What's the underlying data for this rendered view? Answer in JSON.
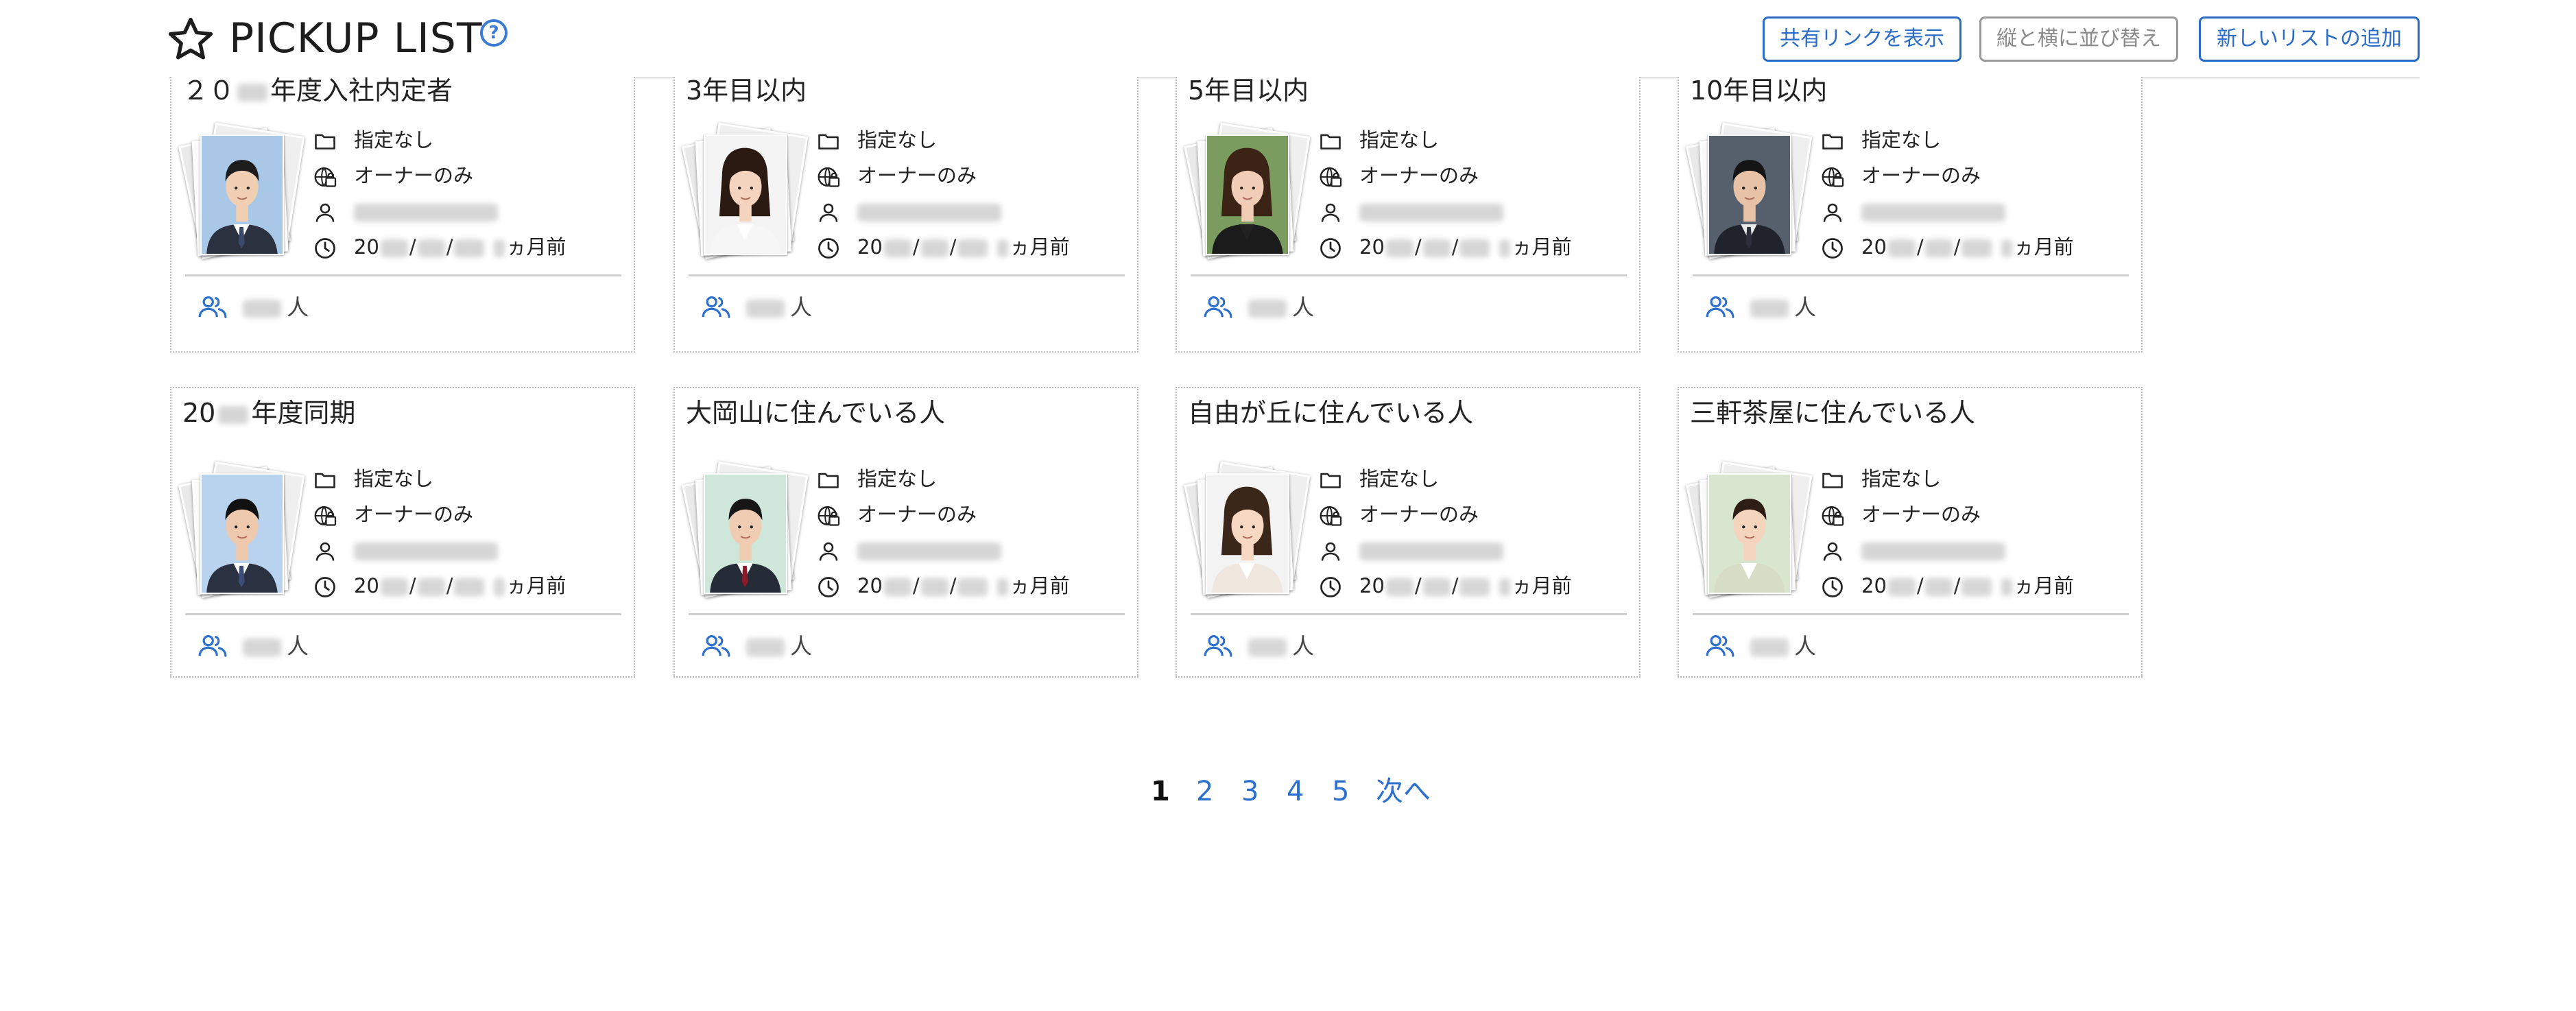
{
  "header": {
    "title": "PICKUP LIST",
    "help_glyph": "?",
    "buttons": {
      "share": "共有リンクを表示",
      "reorder": "縦と横に並び替え",
      "add_list": "新しいリストの追加"
    }
  },
  "cards": [
    {
      "title_pre": "２０",
      "title_post": "年度入社内定者",
      "folder": "指定なし",
      "visibility": "オーナーのみ",
      "date_prefix": "20",
      "sep": "/",
      "date_suffix": "ヵ月前",
      "count_suffix": "人",
      "photo": "man-1"
    },
    {
      "title_pre": "3年目以内",
      "title_post": "",
      "folder": "指定なし",
      "visibility": "オーナーのみ",
      "date_prefix": "20",
      "sep": "/",
      "date_suffix": "ヵ月前",
      "count_suffix": "人",
      "photo": "woman-1"
    },
    {
      "title_pre": "5年目以内",
      "title_post": "",
      "folder": "指定なし",
      "visibility": "オーナーのみ",
      "date_prefix": "20",
      "sep": "/",
      "date_suffix": "ヵ月前",
      "count_suffix": "人",
      "photo": "woman-2"
    },
    {
      "title_pre": "10年目以内",
      "title_post": "",
      "folder": "指定なし",
      "visibility": "オーナーのみ",
      "date_prefix": "20",
      "sep": "/",
      "date_suffix": "ヵ月前",
      "count_suffix": "人",
      "photo": "man-2"
    },
    {
      "title_pre": "20",
      "title_post": "年度同期",
      "folder": "指定なし",
      "visibility": "オーナーのみ",
      "date_prefix": "20",
      "sep": "/",
      "date_suffix": "ヵ月前",
      "count_suffix": "人",
      "photo": "man-3"
    },
    {
      "title_pre": "大岡山に住んでいる人",
      "title_post": "",
      "folder": "指定なし",
      "visibility": "オーナーのみ",
      "date_prefix": "20",
      "sep": "/",
      "date_suffix": "ヵ月前",
      "count_suffix": "人",
      "photo": "man-4"
    },
    {
      "title_pre": "自由が丘に住んでいる人",
      "title_post": "",
      "folder": "指定なし",
      "visibility": "オーナーのみ",
      "date_prefix": "20",
      "sep": "/",
      "date_suffix": "ヵ月前",
      "count_suffix": "人",
      "photo": "woman-3"
    },
    {
      "title_pre": "三軒茶屋に住んでいる人",
      "title_post": "",
      "folder": "指定なし",
      "visibility": "オーナーのみ",
      "date_prefix": "20",
      "sep": "/",
      "date_suffix": "ヵ月前",
      "count_suffix": "人",
      "photo": "woman-4"
    }
  ],
  "pagination": {
    "pages": [
      "1",
      "2",
      "3",
      "4",
      "5"
    ],
    "current": "1",
    "next": "次へ"
  },
  "colors": {
    "accent": "#2a6bc6",
    "border": "#b9b9b9"
  },
  "icons": [
    "star-icon",
    "help-icon",
    "folder-icon",
    "globe-lock-icon",
    "person-icon",
    "clock-icon",
    "people-icon"
  ]
}
